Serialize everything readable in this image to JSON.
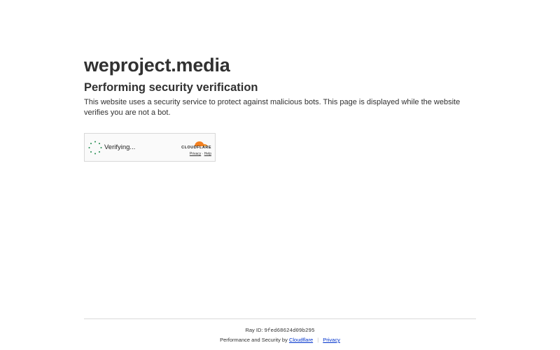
{
  "site": {
    "domain": "weproject.media"
  },
  "main": {
    "heading": "Performing security verification",
    "description": "This website uses a security service to protect against malicious bots. This page is displayed while the website verifies you are not a bot."
  },
  "widget": {
    "status": "Verifying...",
    "brand": "CLOUDFLARE",
    "privacy_link": "Privacy",
    "separator": "·",
    "help_link": "Help",
    "spinner_icon": "spinner-icon",
    "logo_icon": "cloudflare-cloud-icon",
    "accent_color": "#f38020",
    "spinner_color": "#1e8a4c"
  },
  "footer": {
    "ray_label": "Ray ID:",
    "ray_id": "9fed68624d09b295",
    "performance_text": "Performance and Security by",
    "cloudflare_link": "Cloudflare",
    "separator": "|",
    "privacy_link": "Privacy"
  }
}
